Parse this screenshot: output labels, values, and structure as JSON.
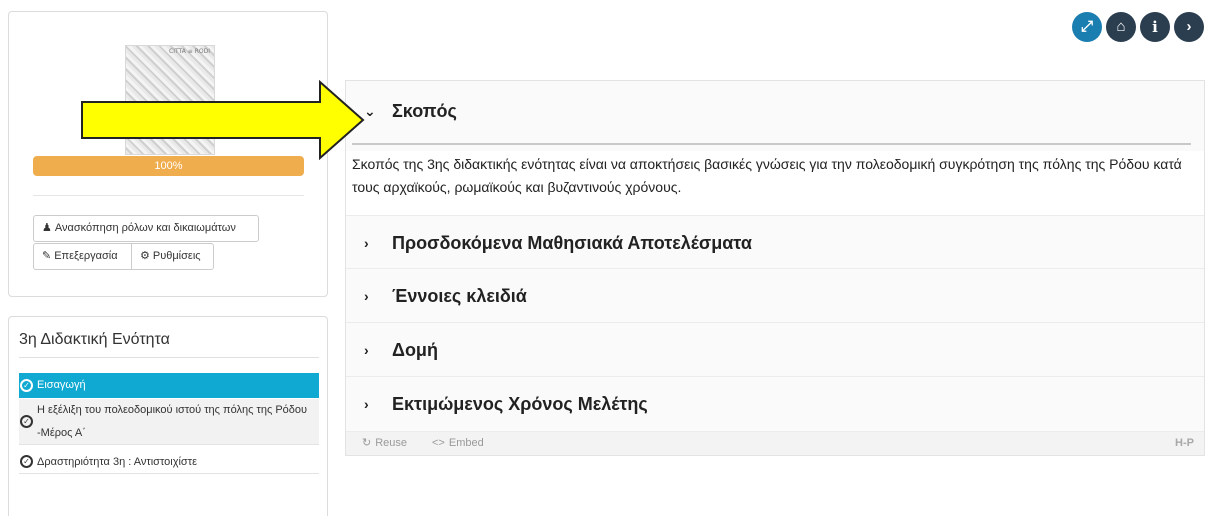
{
  "course": {
    "thumbnail_caption": "CITTA ≡ RODI",
    "progress_text": "100%",
    "progress_value": 1.0,
    "buttons": {
      "roles": "Ανασκόπηση ρόλων και δικαιωμάτων",
      "edit": "Επεξεργασία",
      "settings": "Ρυθμίσεις"
    }
  },
  "lesson": {
    "title": "3η Διδακτική Ενότητα",
    "items": [
      {
        "label": "Εισαγωγή",
        "active": true
      },
      {
        "label_line1": "Η εξέλιξη του πολεοδομικού ιστού της πόλης της Ρόδου",
        "label_line2": "-Μέρος Α΄"
      },
      {
        "label": "Δραστηριότητα 3η : Αντιστοιχίστε"
      }
    ]
  },
  "top_icons": [
    "fullscreen-icon",
    "home-icon",
    "info-icon",
    "next-icon"
  ],
  "accordion": {
    "sections": [
      {
        "title": "Σκοπός",
        "expanded": true,
        "body": "Σκοπός της 3ης διδακτικής ενότητας είναι να αποκτήσεις βασικές γνώσεις για την πολεοδομική συγκρότηση της πόλης της Ρόδου κατά τους αρχαϊκούς, ρωμαϊκούς και βυζαντινούς χρόνους."
      },
      {
        "title": "Προσδοκόμενα Μαθησιακά Αποτελέσματα"
      },
      {
        "title": "Έννοιες κλειδιά"
      },
      {
        "title": "Δομή"
      },
      {
        "title": "Εκτιμώμενος Χρόνος Μελέτης"
      }
    ],
    "footer": {
      "reuse": "Reuse",
      "embed": "Embed",
      "logo": "H-P"
    }
  },
  "colors": {
    "progress": "#f0ad4e",
    "active_item": "#10a9d2",
    "icon_dark": "#2b3e50",
    "icon_fullscreen": "#1a7fb0",
    "arrow_fill": "#ffff00"
  }
}
